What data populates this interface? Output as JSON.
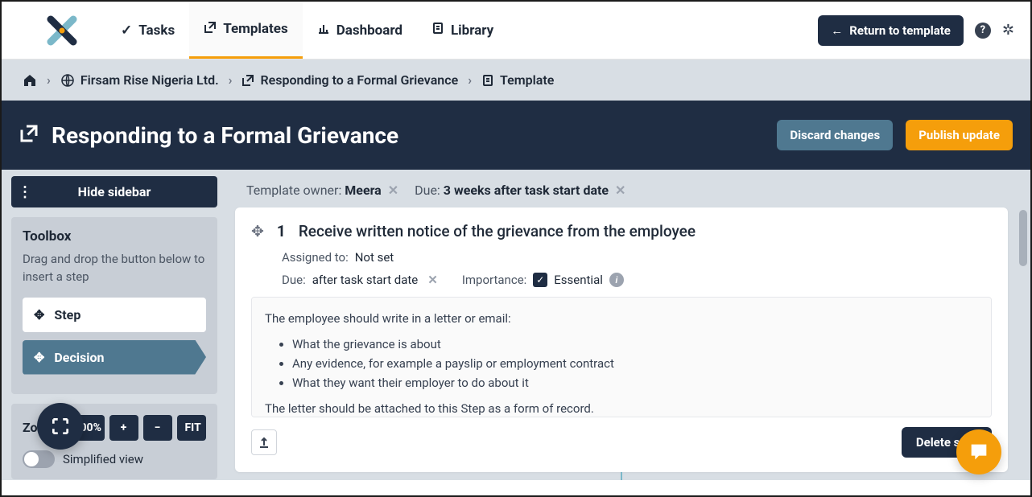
{
  "nav": {
    "tasks": "Tasks",
    "templates": "Templates",
    "dashboard": "Dashboard",
    "library": "Library",
    "return": "Return to template"
  },
  "breadcrumb": {
    "org": "Firsam Rise Nigeria Ltd.",
    "template_name": "Responding to a Formal Grievance",
    "leaf": "Template"
  },
  "titlebar": {
    "title": "Responding to a Formal Grievance",
    "discard": "Discard changes",
    "publish": "Publish update"
  },
  "sidebar": {
    "hide": "Hide sidebar",
    "toolbox_title": "Toolbox",
    "toolbox_desc": "Drag and drop the button below to insert a step",
    "step": "Step",
    "decision": "Decision",
    "zoom_label": "Zoom",
    "zoom_100": "100%",
    "zoom_plus": "+",
    "zoom_minus": "−",
    "zoom_fit": "FIT",
    "simplified": "Simplified view"
  },
  "meta": {
    "owner_label": "Template owner:",
    "owner": "Meera",
    "due_label": "Due:",
    "due": "3 weeks after task start date"
  },
  "step": {
    "number": "1",
    "title": "Receive written notice of the grievance from the employee",
    "assigned_label": "Assigned to:",
    "assigned": "Not set",
    "due_label": "Due:",
    "due": "after task start date",
    "importance_label": "Importance:",
    "importance": "Essential",
    "body_intro": "The employee should write in a letter or email:",
    "bullet1": "What the grievance is about",
    "bullet2": "Any evidence, for example a payslip or employment contract",
    "bullet3": "What they want their employer to do about it",
    "body_outro": "The letter should be attached to this Step as a form of record.",
    "delete": "Delete step"
  }
}
